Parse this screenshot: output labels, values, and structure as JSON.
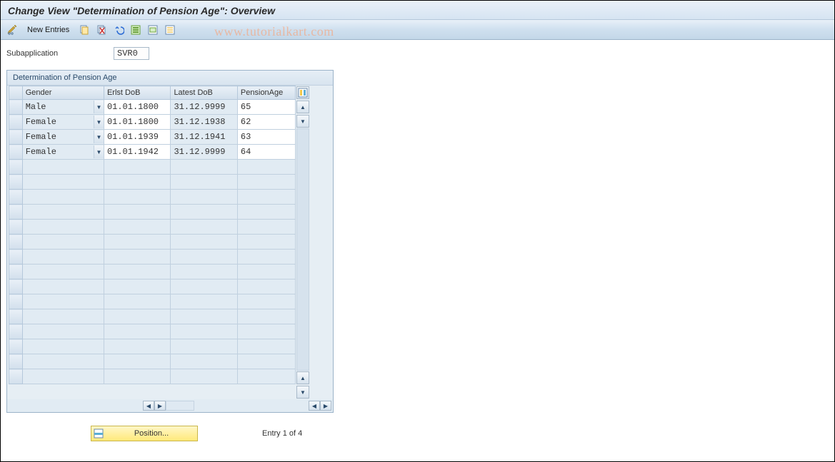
{
  "header": {
    "title": "Change View \"Determination of Pension Age\": Overview"
  },
  "toolbar": {
    "new_entries": "New Entries"
  },
  "watermark": "www.tutorialkart.com",
  "subapp": {
    "label": "Subapplication",
    "value": "SVR0"
  },
  "panel": {
    "title": "Determination of Pension Age",
    "columns": {
      "gender": "Gender",
      "erlst": "Erlst DoB",
      "latest": "Latest DoB",
      "pension": "PensionAge"
    },
    "rows": [
      {
        "gender": "Male",
        "erlst": "01.01.1800",
        "latest": "31.12.9999",
        "pension": "65"
      },
      {
        "gender": "Female",
        "erlst": "01.01.1800",
        "latest": "31.12.1938",
        "pension": "62"
      },
      {
        "gender": "Female",
        "erlst": "01.01.1939",
        "latest": "31.12.1941",
        "pension": "63"
      },
      {
        "gender": "Female",
        "erlst": "01.01.1942",
        "latest": "31.12.9999",
        "pension": "64"
      }
    ],
    "empty_rows": 15
  },
  "footer": {
    "position_label": "Position...",
    "entry_text": "Entry 1 of 4"
  }
}
